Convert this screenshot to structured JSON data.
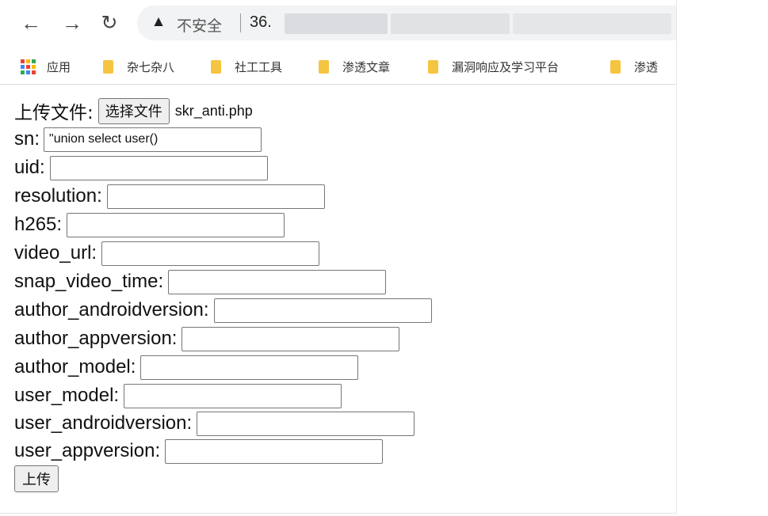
{
  "colors": {
    "omnibox_bg": "#f1f3f4",
    "bookmark_folder": "#f5c542",
    "apps_icon": [
      "#e94235",
      "#fbbc04",
      "#34a853",
      "#4285f4",
      "#e94235",
      "#fbbc04",
      "#34a853",
      "#4285f4",
      "#e94235"
    ]
  },
  "toolbar": {
    "back_icon": "arrow-left",
    "forward_icon": "arrow-right",
    "reload_icon": "reload",
    "security_icon": "warning-triangle",
    "security_status": "不安全",
    "url": "36."
  },
  "bookmarks": [
    {
      "label": "应用",
      "icon": "apps-grid"
    },
    {
      "label": "杂七杂八",
      "icon": "folder"
    },
    {
      "label": "社工工具",
      "icon": "folder"
    },
    {
      "label": "渗透文章",
      "icon": "folder"
    },
    {
      "label": "漏洞响应及学习平台",
      "icon": "folder"
    },
    {
      "label": "渗透",
      "icon": "folder"
    }
  ],
  "form": {
    "file_label": "上传文件:",
    "file_button": "选择文件",
    "file_name": "skr_anti.php",
    "fields": [
      {
        "label": "sn:",
        "value": "\"union select user()"
      },
      {
        "label": "uid:",
        "value": ""
      },
      {
        "label": "resolution:",
        "value": ""
      },
      {
        "label": "h265:",
        "value": ""
      },
      {
        "label": "video_url:",
        "value": ""
      },
      {
        "label": "snap_video_time:",
        "value": ""
      },
      {
        "label": "author_androidversion:",
        "value": ""
      },
      {
        "label": "author_appversion:",
        "value": ""
      },
      {
        "label": "author_model:",
        "value": ""
      },
      {
        "label": "user_model:",
        "value": ""
      },
      {
        "label": "user_androidversion:",
        "value": ""
      },
      {
        "label": "user_appversion:",
        "value": ""
      }
    ],
    "submit_button": "上传"
  }
}
